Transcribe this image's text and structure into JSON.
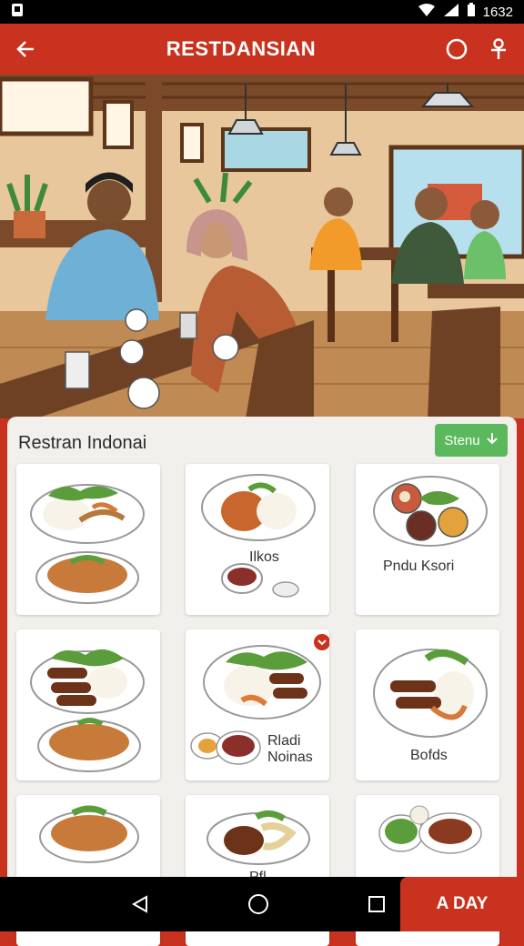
{
  "status_bar": {
    "time": "1632",
    "signal_icon": "signal-icon",
    "wifi_icon": "wifi-icon",
    "battery_icon": "battery-icon"
  },
  "app_bar": {
    "title": "RESTDANSIAN",
    "back_icon": "back-arrow-icon",
    "search_icon": "circle-icon",
    "share_icon": "share-icon"
  },
  "panel": {
    "title": "Restran Indonai",
    "menu_button": "Stenu"
  },
  "cards": [
    {
      "label": ""
    },
    {
      "label": "Ilkos"
    },
    {
      "label": "Pndu Ksori"
    },
    {
      "label": ""
    },
    {
      "label": "Rladi Noinas"
    },
    {
      "label": "Bofds"
    },
    {
      "label": ""
    },
    {
      "label": "Pfl"
    },
    {
      "label": ""
    }
  ],
  "bottom": {
    "cta_label": "A DAY"
  },
  "colors": {
    "primary": "#c8321e",
    "accent_green": "#5cb85c",
    "panel_bg": "#f2f0ed"
  }
}
